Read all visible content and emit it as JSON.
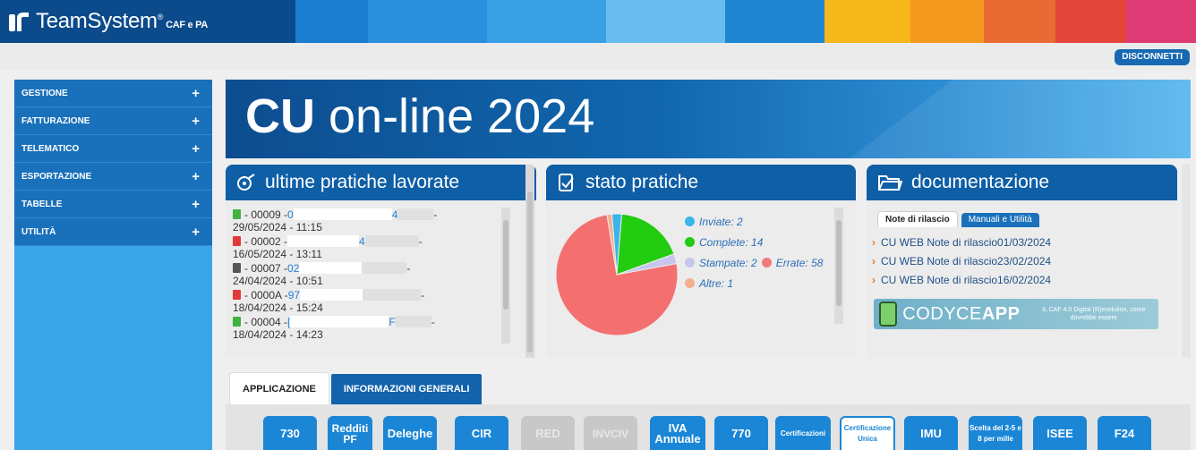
{
  "header": {
    "brand": "TeamSystem",
    "brand_mark": "®",
    "brand_suffix": "CAF e PA",
    "disconnect_label": "DISCONNETTI",
    "stripe_colors": [
      "#1b7dd0",
      "#2a8fdc",
      "#3aa0e6",
      "#6abdf0",
      "#1f86d4",
      "#f6b81a",
      "#f39a1e",
      "#ea6a34",
      "#e4453b",
      "#de3a73"
    ]
  },
  "sidebar": {
    "items": [
      {
        "label": "GESTIONE",
        "icon": "plus-icon"
      },
      {
        "label": "FATTURAZIONE",
        "icon": "plus-icon"
      },
      {
        "label": "TELEMATICO",
        "icon": "plus-icon"
      },
      {
        "label": "ESPORTAZIONE",
        "icon": "plus-icon"
      },
      {
        "label": "TABELLE",
        "icon": "plus-icon"
      },
      {
        "label": "UTILITÀ",
        "icon": "plus-icon"
      }
    ]
  },
  "banner": {
    "title_bold": "CU",
    "title_rest": " on-line 2024"
  },
  "ultime_pratiche": {
    "title": "ultime pratiche lavorate",
    "rows": [
      {
        "id": " - 00009  - ",
        "ref": "0",
        "ref_tail": "4",
        "date": "29/05/2024 - 11:15",
        "icon": "xls-file-icon"
      },
      {
        "id": " - 00002  - ",
        "ref": "",
        "ref_tail": "4",
        "date": "16/05/2024 - 13:11",
        "icon": "pdf-file-icon"
      },
      {
        "id": " - 00007  - ",
        "ref": "02",
        "ref_tail": "",
        "date": "24/04/2024 - 10:51",
        "icon": "printer-icon"
      },
      {
        "id": " - 0000A  - ",
        "ref": "97",
        "ref_tail": "",
        "date": "18/04/2024 - 15:24",
        "icon": "pdf-file-icon"
      },
      {
        "id": " - 00004  - ",
        "ref": "[",
        "ref_tail": "F",
        "date": "18/04/2024 - 14:23",
        "icon": "xls-file-icon"
      }
    ]
  },
  "stato_pratiche": {
    "title": "stato pratiche",
    "legend": [
      {
        "label": "Inviate: 2",
        "color": "#3ab4ea"
      },
      {
        "label": "Complete: 14",
        "color": "#22cc11"
      },
      {
        "label": "Stampate: 2",
        "color": "#c6c6ee"
      },
      {
        "label": "Errate: 58",
        "color": "#f07b7b"
      },
      {
        "label": "Altre: 1",
        "color": "#f4b08c"
      }
    ]
  },
  "chart_data": {
    "type": "pie",
    "categories": [
      "Inviate",
      "Complete",
      "Stampate",
      "Errate",
      "Altre"
    ],
    "values": [
      2,
      14,
      2,
      58,
      1
    ],
    "colors": [
      "#3ab4ea",
      "#22cc11",
      "#c6c6ee",
      "#f47070",
      "#f4b08c"
    ]
  },
  "documentazione": {
    "title": "documentazione",
    "tab_active": "Note di rilascio",
    "tab_inactive": "Manuali e Utilità",
    "items": [
      {
        "text": "CU WEB Note di rilascio",
        "date": " 01/03/2024"
      },
      {
        "text": "CU WEB Note di rilascio",
        "date": " 23/02/2024"
      },
      {
        "text": "CU WEB Note di rilascio",
        "date": " 16/02/2024"
      }
    ],
    "promo_name_light": "CODYCE",
    "promo_name_bold": "APP",
    "promo_tagline": "IL CAF 4.0 Digital (R)evolution, come dovrebbe essere"
  },
  "bottom_tabs": {
    "active": "APPLICAZIONE",
    "inactive": "INFORMAZIONI GENERALI"
  },
  "apps": [
    {
      "label": "730",
      "state": "enabled"
    },
    {
      "label": "Redditi PF",
      "state": "enabled"
    },
    {
      "label": "Deleghe",
      "state": "enabled"
    },
    {
      "label": "CIR",
      "state": "enabled"
    },
    {
      "label": "RED",
      "state": "disabled"
    },
    {
      "label": "INVCIV",
      "state": "disabled"
    },
    {
      "label": "IVA Annuale",
      "state": "enabled"
    },
    {
      "label": "770",
      "state": "enabled"
    },
    {
      "label": "Certificazioni",
      "state": "enabled"
    },
    {
      "label": "Certificazione Unica",
      "state": "selected"
    },
    {
      "label": "IMU",
      "state": "enabled"
    },
    {
      "label": "Scelta del 2-5 e 8 per mille",
      "state": "enabled"
    },
    {
      "label": "ISEE",
      "state": "enabled"
    },
    {
      "label": "F24",
      "state": "enabled"
    }
  ]
}
